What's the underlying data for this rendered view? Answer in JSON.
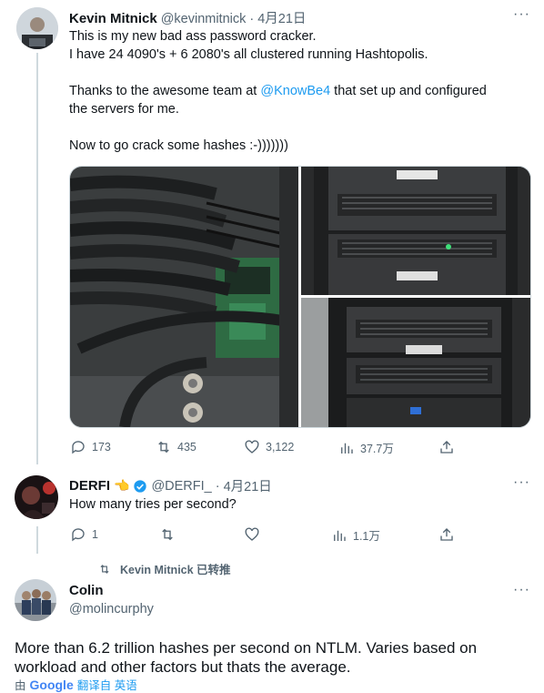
{
  "tweet1": {
    "name": "Kevin Mitnick",
    "handle": "@kevinmitnick",
    "sep": "·",
    "date": "4月21日",
    "lines": [
      "This is my new bad ass password cracker.",
      "I have 24 4090's + 6 2080's all clustered running Hashtopolis.",
      "",
      "Thanks to the awesome team at ",
      " that set up and configured",
      "the servers for me.",
      "",
      "Now to go crack some hashes :-)))))))"
    ],
    "mention": "@KnowBe4",
    "stats": {
      "replies": "173",
      "retweets": "435",
      "likes": "3,122",
      "views": "37.7万"
    }
  },
  "tweet2": {
    "name": "DERFI",
    "emoji": "👈",
    "handle": "@DERFI_",
    "sep": "·",
    "date": "4月21日",
    "text": "How many tries per second?",
    "stats": {
      "replies": "1",
      "retweets": "",
      "likes": "",
      "views": "1.1万"
    }
  },
  "retweet_note": "Kevin Mitnick 已转推",
  "tweet3": {
    "name": "Colin",
    "handle": "@molincurphy",
    "text_line1": "More than 6.2 trillion hashes per second on NTLM. Varies based on",
    "text_line2": "workload and other factors but thats the average.",
    "translate_prefix": "由",
    "translate_brand": "Google",
    "translate_label": "翻译自 英语"
  },
  "more_icon": "···",
  "colors": {
    "accent": "#1d9bf0",
    "muted": "#536471",
    "text": "#0f1419"
  }
}
